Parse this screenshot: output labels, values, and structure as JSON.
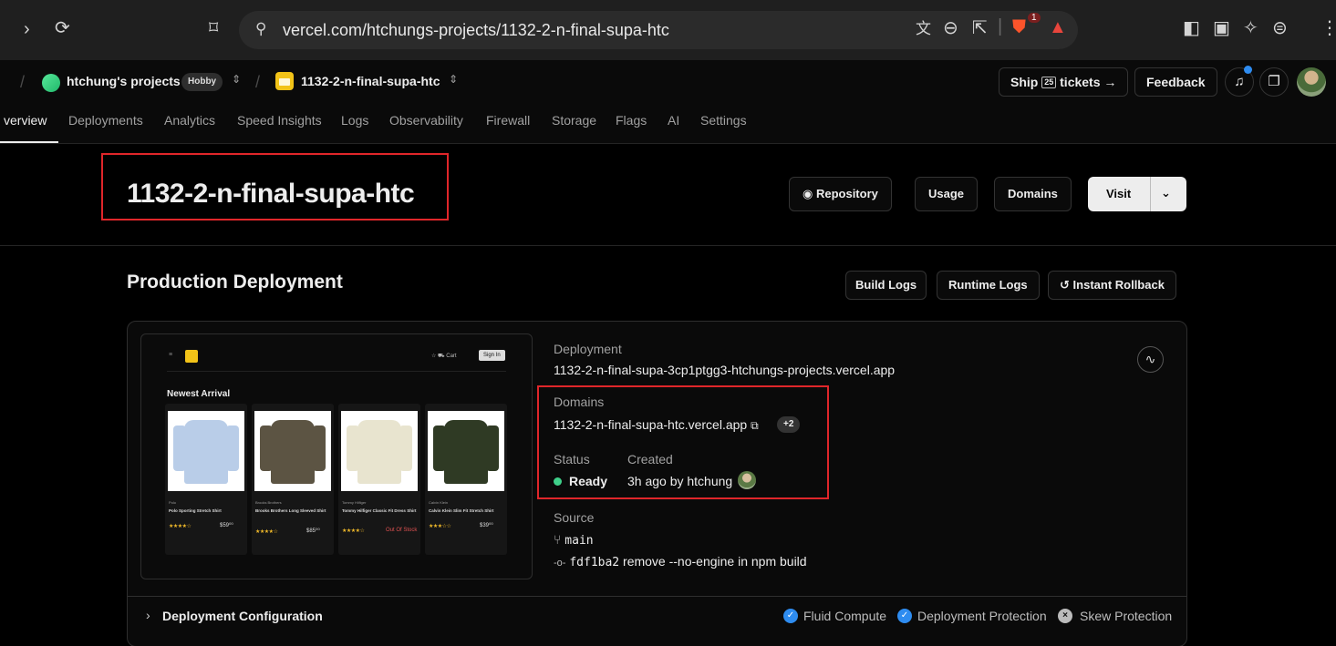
{
  "browser": {
    "url": "vercel.com/htchungs-projects/1132-2-n-final-supa-htc",
    "brave_badge": "1"
  },
  "header": {
    "team_name": "htchung's projects",
    "plan_badge": "Hobby",
    "project_name": "1132-2-n-final-supa-htc",
    "ship_label_1": "Ship",
    "ship_number": "25",
    "ship_label_2": "tickets →",
    "feedback_label": "Feedback"
  },
  "tabs": [
    {
      "label": "verview"
    },
    {
      "label": "Deployments"
    },
    {
      "label": "Analytics"
    },
    {
      "label": "Speed Insights"
    },
    {
      "label": "Logs"
    },
    {
      "label": "Observability"
    },
    {
      "label": "Firewall"
    },
    {
      "label": "Storage"
    },
    {
      "label": "Flags"
    },
    {
      "label": "AI"
    },
    {
      "label": "Settings"
    }
  ],
  "project": {
    "title": "1132-2-n-final-supa-htc",
    "repository_label": "Repository",
    "usage_label": "Usage",
    "domains_label": "Domains",
    "visit_label": "Visit"
  },
  "production": {
    "title": "Production Deployment",
    "build_logs": "Build Logs",
    "runtime_logs": "Runtime Logs",
    "instant_rollback": "Instant Rollback",
    "deployment_label": "Deployment",
    "deployment_url": "1132-2-n-final-supa-3cp1ptgg3-htchungs-projects.vercel.app",
    "domains_label": "Domains",
    "domain_url": "1132-2-n-final-supa-htc.vercel.app",
    "domain_extra": "+2",
    "status_label": "Status",
    "created_label": "Created",
    "status_value": "Ready",
    "created_value": "3h ago by htchung",
    "source_label": "Source",
    "branch": "main",
    "commit_hash": "fdf1ba2",
    "commit_message": "remove --no-engine in npm build"
  },
  "preview": {
    "cart": "Cart",
    "sign_in": "Sign In",
    "heading": "Newest Arrival",
    "products": [
      {
        "brand": "Polo",
        "name": "Polo Sporting Stretch Shirt",
        "stars": "★★★★☆",
        "price": "$59⁰⁰",
        "color": "#b9cde8"
      },
      {
        "brand": "Brooks Brothers",
        "name": "Brooks Brothers Long Sleeved Shirt",
        "stars": "★★★★☆",
        "price": "$85⁰⁰",
        "color": "#5c5443"
      },
      {
        "brand": "Tommy Hilfiger",
        "name": "Tommy Hilfiger Classic Fit Dress Shirt",
        "stars": "★★★★☆",
        "price": "Out Of Stock",
        "color": "#e8e4cf"
      },
      {
        "brand": "Calvin Klein",
        "name": "Calvin Klein Slim Fit Stretch Shirt",
        "stars": "★★★☆☆",
        "price": "$39⁰⁰",
        "color": "#2f3a24"
      }
    ]
  },
  "config": {
    "title": "Deployment Configuration",
    "fluid_compute": "Fluid Compute",
    "deployment_protection": "Deployment Protection",
    "skew_protection": "Skew Protection"
  }
}
